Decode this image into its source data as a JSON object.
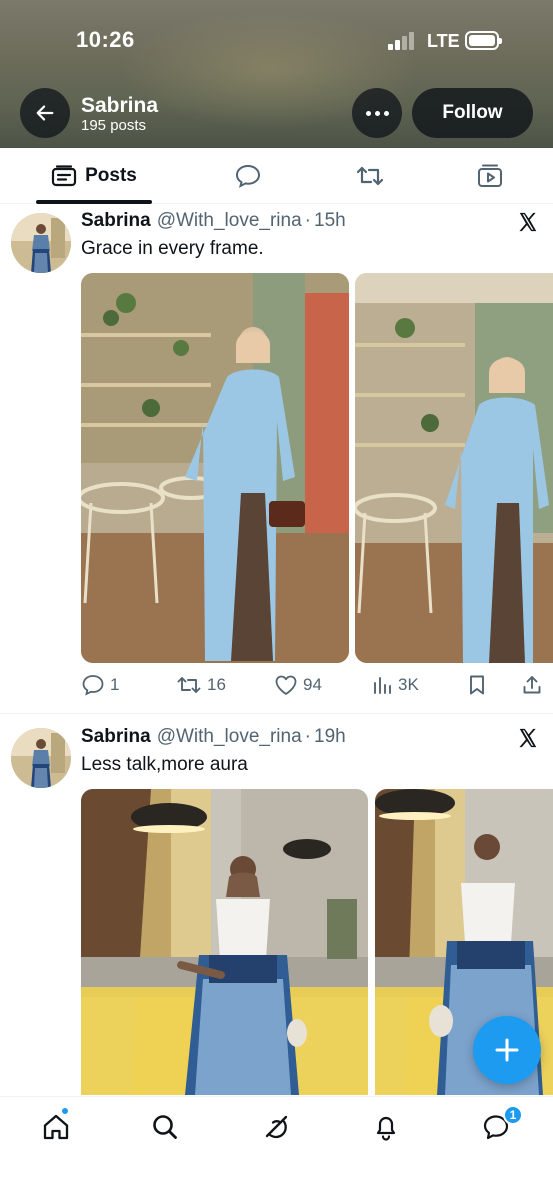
{
  "status_bar": {
    "time": "10:26",
    "network": "LTE"
  },
  "profile_header": {
    "name": "Sabrina",
    "post_count": "195 posts",
    "follow_label": "Follow"
  },
  "tabs": [
    {
      "label": "Posts",
      "icon": "posts-icon",
      "active": true
    },
    {
      "label": "",
      "icon": "replies-icon",
      "active": false
    },
    {
      "label": "",
      "icon": "reposts-icon",
      "active": false
    },
    {
      "label": "",
      "icon": "media-icon",
      "active": false
    }
  ],
  "posts": [
    {
      "author": "Sabrina",
      "handle": "@With_love_rina",
      "separator": "·",
      "time": "15h",
      "text": "Grace in every frame.",
      "replies": "1",
      "reposts": "16",
      "likes": "94",
      "views": "3K"
    },
    {
      "author": "Sabrina",
      "handle": "@With_love_rina",
      "separator": "·",
      "time": "19h",
      "text": "Less talk,more aura"
    }
  ],
  "bottom_nav": {
    "items": [
      "home-icon",
      "search-icon",
      "grok-icon",
      "notifications-icon",
      "messages-icon"
    ],
    "messages_badge": "1"
  },
  "colors": {
    "accent": "#1d9bf0",
    "text": "#0f1419",
    "secondary_text": "#536471"
  }
}
